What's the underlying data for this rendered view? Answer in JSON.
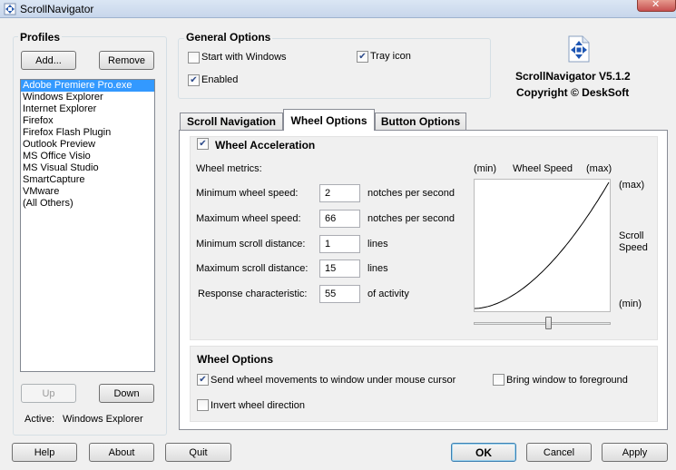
{
  "window": {
    "title": "ScrollNavigator"
  },
  "profiles": {
    "title": "Profiles",
    "add_label": "Add...",
    "remove_label": "Remove",
    "items": [
      "Adobe Premiere Pro.exe",
      "Windows Explorer",
      "Internet Explorer",
      "Firefox",
      "Firefox Flash Plugin",
      "Outlook Preview",
      "MS Office Visio",
      "MS Visual Studio",
      "SmartCapture",
      "VMware",
      "(All Others)"
    ],
    "selected_index": 0,
    "up_label": "Up",
    "down_label": "Down",
    "active_label": "Active:",
    "active_value": "Windows Explorer"
  },
  "general": {
    "title": "General Options",
    "start_with_windows": {
      "label": "Start with Windows",
      "checked": false
    },
    "tray_icon": {
      "label": "Tray icon",
      "checked": true
    },
    "enabled": {
      "label": "Enabled",
      "checked": true
    }
  },
  "about": {
    "version": "ScrollNavigator V5.1.2",
    "copyright": "Copyright © DeskSoft"
  },
  "tabs": [
    {
      "label": "Scroll Navigation",
      "active": false
    },
    {
      "label": "Wheel Options",
      "active": true
    },
    {
      "label": "Button Options",
      "active": false
    }
  ],
  "accel": {
    "title": "Wheel Acceleration",
    "checked": true,
    "metrics_label": "Wheel metrics:",
    "rows": [
      {
        "label": "Minimum wheel speed:",
        "value": "2",
        "unit": "notches per second"
      },
      {
        "label": "Maximum wheel speed:",
        "value": "66",
        "unit": "notches per second"
      },
      {
        "label": "Minimum scroll distance:",
        "value": "1",
        "unit": "lines"
      },
      {
        "label": "Maximum scroll distance:",
        "value": "15",
        "unit": "lines"
      },
      {
        "label": "Response characteristic:",
        "value": "55",
        "unit": "of activity"
      }
    ],
    "graph": {
      "x_min_label": "(min)",
      "x_title": "Wheel Speed",
      "x_max_label": "(max)",
      "y_max_label": "(max)",
      "y_title_line1": "Scroll",
      "y_title_line2": "Speed",
      "y_min_label": "(min)",
      "slider_value": 0.55
    }
  },
  "wheel_options": {
    "title": "Wheel Options",
    "send_under_cursor": {
      "label": "Send wheel movements to window under mouse cursor",
      "checked": true
    },
    "bring_foreground": {
      "label": "Bring window to foreground",
      "checked": false
    },
    "invert": {
      "label": "Invert wheel direction",
      "checked": false
    }
  },
  "footer": {
    "help_label": "Help",
    "about_label": "About",
    "quit_label": "Quit",
    "ok_label": "OK",
    "cancel_label": "Cancel",
    "apply_label": "Apply"
  }
}
